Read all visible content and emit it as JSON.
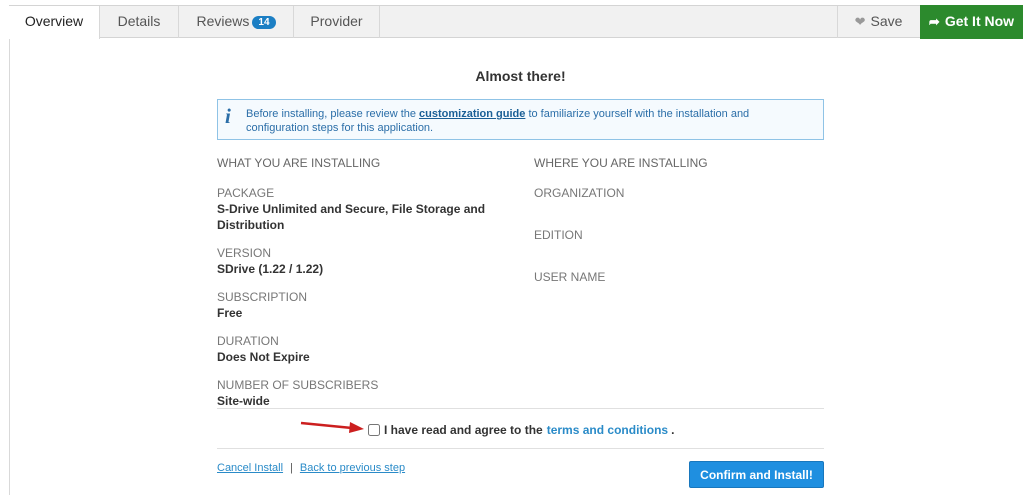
{
  "tabs": [
    {
      "label": "Overview",
      "active": true
    },
    {
      "label": "Details"
    },
    {
      "label": "Reviews",
      "badge": "14"
    },
    {
      "label": "Provider"
    }
  ],
  "actions": {
    "save": "Save",
    "get_it_now": "Get It Now"
  },
  "title": "Almost there!",
  "info": {
    "text_before": "Before installing, please review the",
    "link": "customization guide",
    "text_after": "to familiarize yourself with the installation and configuration steps for this application."
  },
  "installing": {
    "heading": "WHAT YOU ARE INSTALLING",
    "fields": [
      {
        "label": "PACKAGE",
        "value": "S-Drive Unlimited and Secure, File Storage and Distribution"
      },
      {
        "label": "VERSION",
        "value": "SDrive (1.22 / 1.22)"
      },
      {
        "label": "SUBSCRIPTION",
        "value": "Free"
      },
      {
        "label": "DURATION",
        "value": "Does Not Expire"
      },
      {
        "label": "NUMBER OF SUBSCRIBERS",
        "value": "Site-wide"
      }
    ]
  },
  "target": {
    "heading": "WHERE YOU ARE INSTALLING",
    "labels": [
      "ORGANIZATION",
      "EDITION",
      "USER NAME"
    ]
  },
  "agree": {
    "text": "I have read and agree to the",
    "link": "terms and conditions",
    "suffix": ".",
    "checked": false
  },
  "footer": {
    "cancel": "Cancel Install",
    "separator": "|",
    "back": "Back to previous step",
    "confirm": "Confirm and Install!"
  },
  "colors": {
    "accent": "#1f8fe0",
    "get_it": "#2c8a2d",
    "badge": "#1c7fc4",
    "annotation_arrow": "#cc1f1f"
  }
}
